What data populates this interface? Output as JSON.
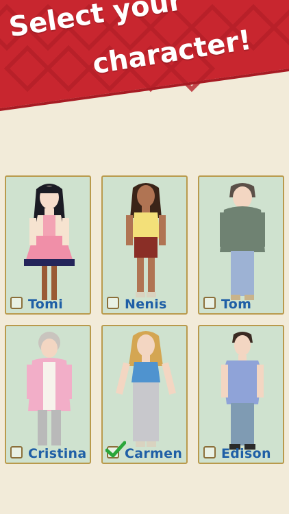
{
  "header": {
    "title_line1": "Select your",
    "title_line2": "character!"
  },
  "accent_colors": {
    "banner": "#c8262f",
    "card_bg": "#cfe2cf",
    "card_border": "#b99a4c",
    "name_text": "#1f5fa6",
    "check_green": "#2aa63a"
  },
  "characters": [
    {
      "name": "Tomi",
      "selected": false
    },
    {
      "name": "Nenis",
      "selected": false
    },
    {
      "name": "Tom",
      "selected": false
    },
    {
      "name": "Cristina",
      "selected": false
    },
    {
      "name": "Carmen",
      "selected": true
    },
    {
      "name": "Edison",
      "selected": false
    }
  ]
}
